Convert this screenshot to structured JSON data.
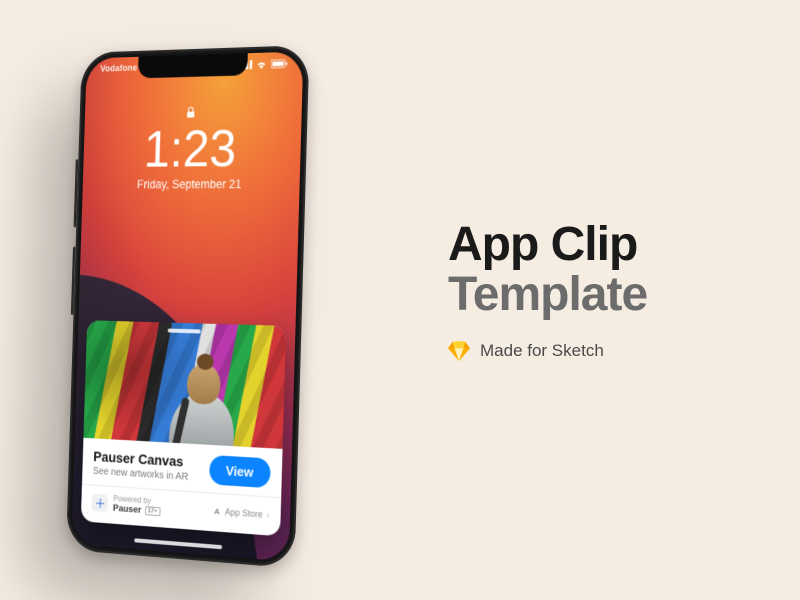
{
  "headline": {
    "line1": "App Clip",
    "line2": "Template"
  },
  "subline": "Made for Sketch",
  "statusbar": {
    "carrier": "Vodafone"
  },
  "lockscreen": {
    "time": "1:23",
    "date": "Friday, September 21"
  },
  "clip": {
    "title": "Pauser Canvas",
    "subtitle": "See new artworks in AR",
    "view_label": "View",
    "powered_label": "Powered by",
    "app_name": "Pauser",
    "age_rating": "17+",
    "appstore_label": "App Store"
  }
}
